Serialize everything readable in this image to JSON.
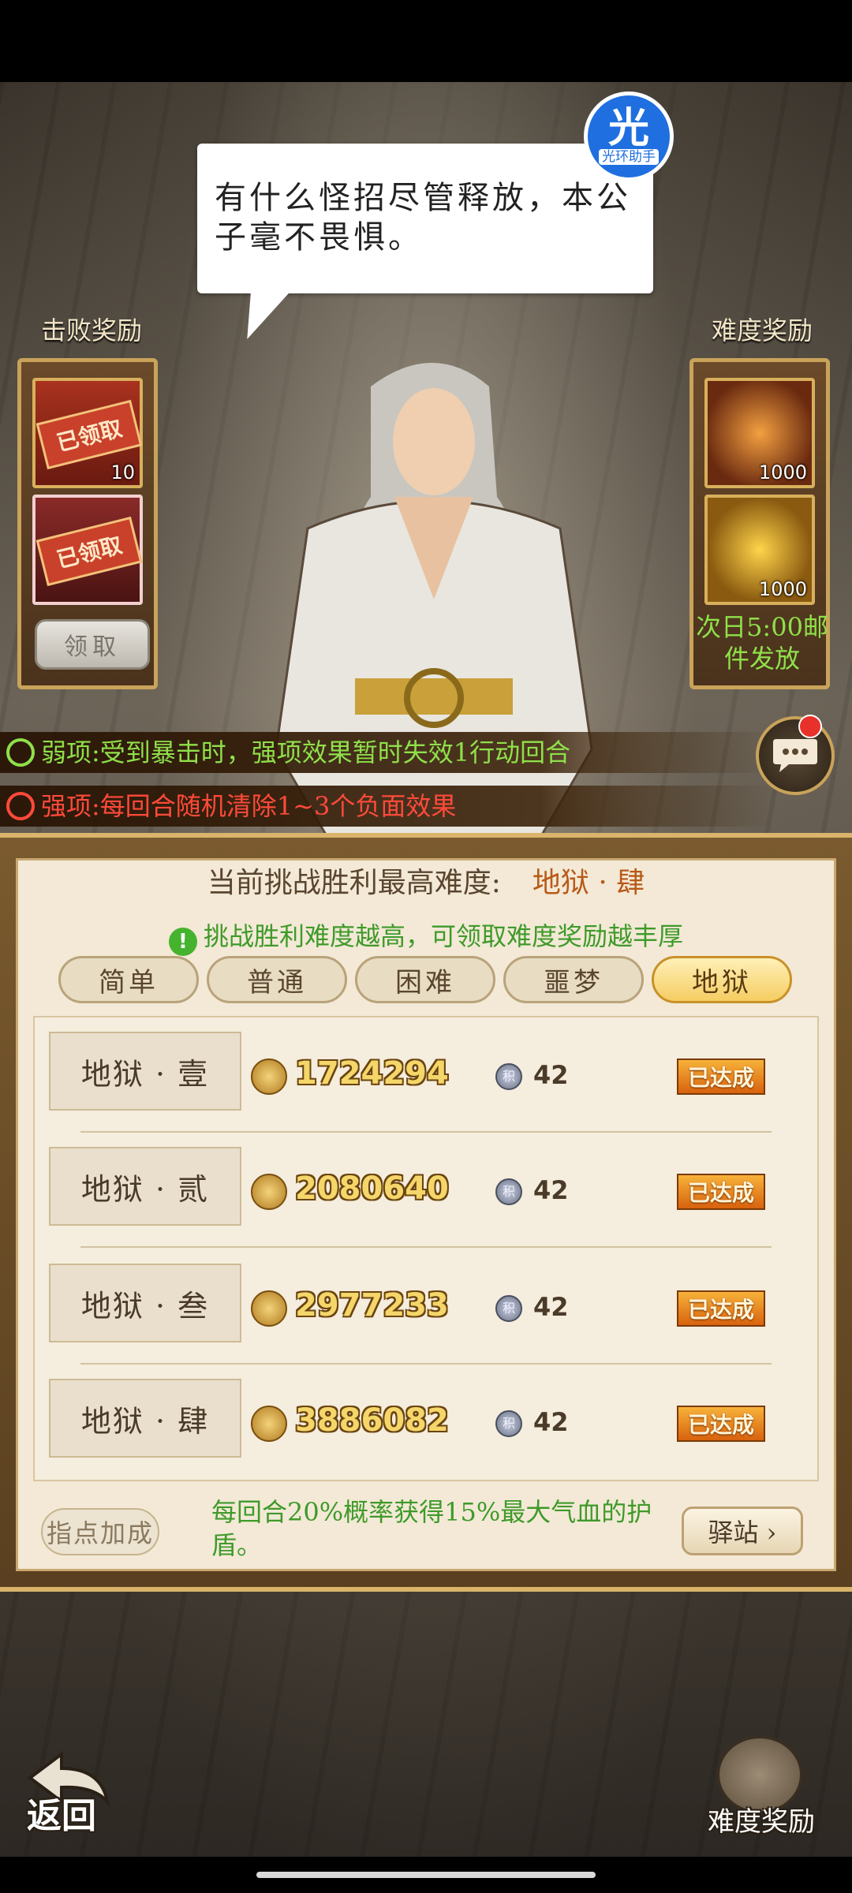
{
  "dialogue": {
    "text": "有什么怪招尽管释放，本公子毫不畏惧。"
  },
  "helper_logo": {
    "big": "光",
    "small": "光环助手"
  },
  "defeat_rewards": {
    "title": "击败奖励",
    "items": [
      {
        "stamp": "已领取",
        "count": "10",
        "icon": "red-scroll-chest-icon"
      },
      {
        "stamp": "已领取",
        "count": "",
        "icon": "red-treasure-chest-icon"
      }
    ],
    "claim_button": "领取"
  },
  "difficulty_rewards_side": {
    "title": "难度奖励",
    "items": [
      {
        "icon": "flame-flower-icon",
        "count": "1000"
      },
      {
        "icon": "gold-ingot-icon",
        "count": "1000"
      }
    ],
    "note": "次日5:00邮件发放"
  },
  "effects": {
    "weak": {
      "text": "弱项:受到暴击时，强项效果暂时失效1行动回合",
      "color": "#8fe04a"
    },
    "strong": {
      "text": "强项:每回合随机清除1~3个负面效果",
      "color": "#ff4a3a"
    }
  },
  "header": {
    "label": "当前挑战胜利最高难度:",
    "value": "地狱 · 肆"
  },
  "tip": "挑战胜利难度越高，可领取难度奖励越丰厚",
  "tabs": [
    {
      "label": "简单",
      "active": false
    },
    {
      "label": "普通",
      "active": false
    },
    {
      "label": "困难",
      "active": false
    },
    {
      "label": "噩梦",
      "active": false
    },
    {
      "label": "地狱",
      "active": true
    }
  ],
  "rows": [
    {
      "name": "地狱 · 壹",
      "power": "1724294",
      "points": "42",
      "status": "已达成"
    },
    {
      "name": "地狱 · 贰",
      "power": "2080640",
      "points": "42",
      "status": "已达成"
    },
    {
      "name": "地狱 · 叁",
      "power": "2977233",
      "points": "42",
      "status": "已达成"
    },
    {
      "name": "地狱 · 肆",
      "power": "3886082",
      "points": "42",
      "status": "已达成"
    }
  ],
  "points_icon_char": "积",
  "bonus": {
    "button": "指点加成",
    "text": "每回合20%概率获得15%最大气血的护盾。"
  },
  "station_button": "驿站 ›",
  "bottom": {
    "back": "返回",
    "difficulty_reward": "难度奖励"
  },
  "colors": {
    "accent": "#b85a18",
    "green": "#3f9a2a",
    "done": "#d8620e"
  }
}
